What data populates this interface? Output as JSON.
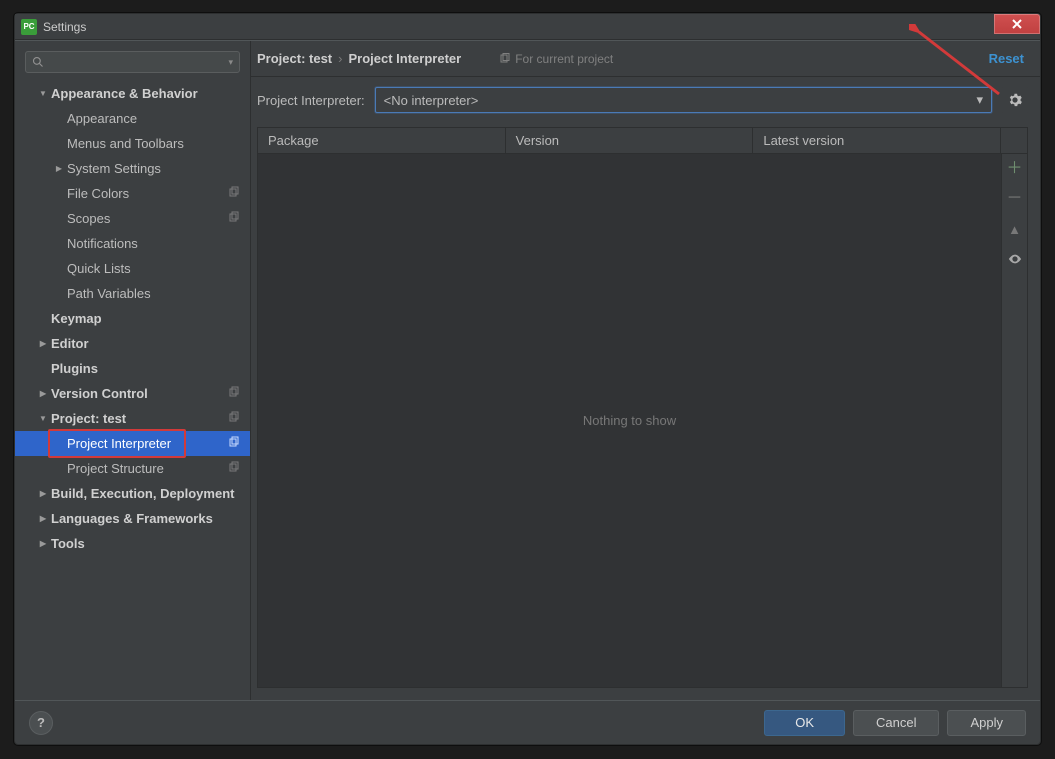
{
  "window": {
    "title": "Settings"
  },
  "search": {
    "placeholder": ""
  },
  "sidebar": {
    "items": [
      {
        "label": "Appearance & Behavior",
        "bold": true,
        "indent": 0,
        "arrow": "down"
      },
      {
        "label": "Appearance",
        "indent": 1
      },
      {
        "label": "Menus and Toolbars",
        "indent": 1
      },
      {
        "label": "System Settings",
        "indent": 1,
        "arrow": "right"
      },
      {
        "label": "File Colors",
        "indent": 1,
        "copy": true
      },
      {
        "label": "Scopes",
        "indent": 1,
        "copy": true
      },
      {
        "label": "Notifications",
        "indent": 1
      },
      {
        "label": "Quick Lists",
        "indent": 1
      },
      {
        "label": "Path Variables",
        "indent": 1
      },
      {
        "label": "Keymap",
        "bold": true,
        "indent": 0
      },
      {
        "label": "Editor",
        "bold": true,
        "indent": 0,
        "arrow": "right"
      },
      {
        "label": "Plugins",
        "bold": true,
        "indent": 0
      },
      {
        "label": "Version Control",
        "bold": true,
        "indent": 0,
        "arrow": "right",
        "copy": true
      },
      {
        "label": "Project: test",
        "bold": true,
        "indent": 0,
        "arrow": "down",
        "copy": true
      },
      {
        "label": "Project Interpreter",
        "indent": 1,
        "copy": true,
        "selected": true,
        "box": true
      },
      {
        "label": "Project Structure",
        "indent": 1,
        "copy": true
      },
      {
        "label": "Build, Execution, Deployment",
        "bold": true,
        "indent": 0,
        "arrow": "right"
      },
      {
        "label": "Languages & Frameworks",
        "bold": true,
        "indent": 0,
        "arrow": "right"
      },
      {
        "label": "Tools",
        "bold": true,
        "indent": 0,
        "arrow": "right"
      }
    ]
  },
  "breadcrumb": {
    "seg1": "Project: test",
    "seg2": "Project Interpreter"
  },
  "for_current_project": "For current project",
  "reset": "Reset",
  "interp_label": "Project Interpreter:",
  "combo_value": "<No interpreter>",
  "table": {
    "columns": [
      "Package",
      "Version",
      "Latest version"
    ],
    "empty_text": "Nothing to show"
  },
  "buttons": {
    "ok": "OK",
    "cancel": "Cancel",
    "apply": "Apply"
  },
  "help": "?"
}
